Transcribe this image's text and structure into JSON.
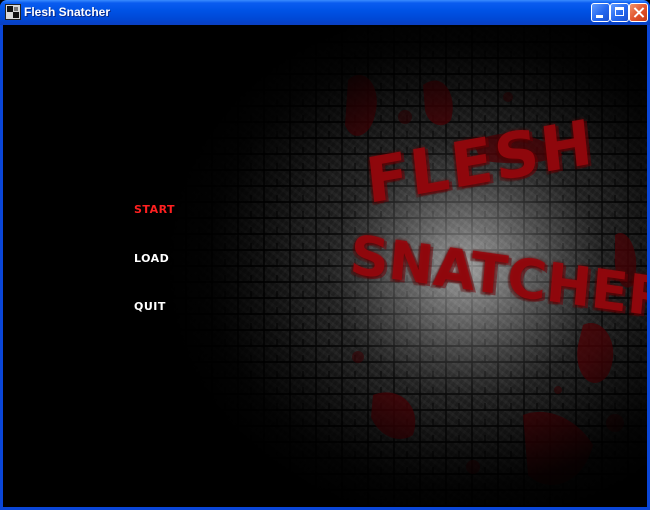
{
  "window": {
    "title": "Flesh Snatcher",
    "title_color": "#ffffff",
    "titlebar_color": "#0054e3",
    "controls": {
      "minimize": "minimize-icon",
      "maximize": "maximize-icon",
      "close": "close-icon"
    }
  },
  "menu": {
    "items": [
      {
        "label": "START",
        "selected": true
      },
      {
        "label": "LOAD",
        "selected": false
      },
      {
        "label": "QUIT",
        "selected": false
      }
    ],
    "selected_color": "#ff2020",
    "normal_color": "#ffffff"
  },
  "logo": {
    "line1": "FLESH",
    "line2": "SNATCHER",
    "color": "#96080e"
  },
  "background": {
    "texture": "stone-brick-wall",
    "spotlight": "right-center"
  }
}
